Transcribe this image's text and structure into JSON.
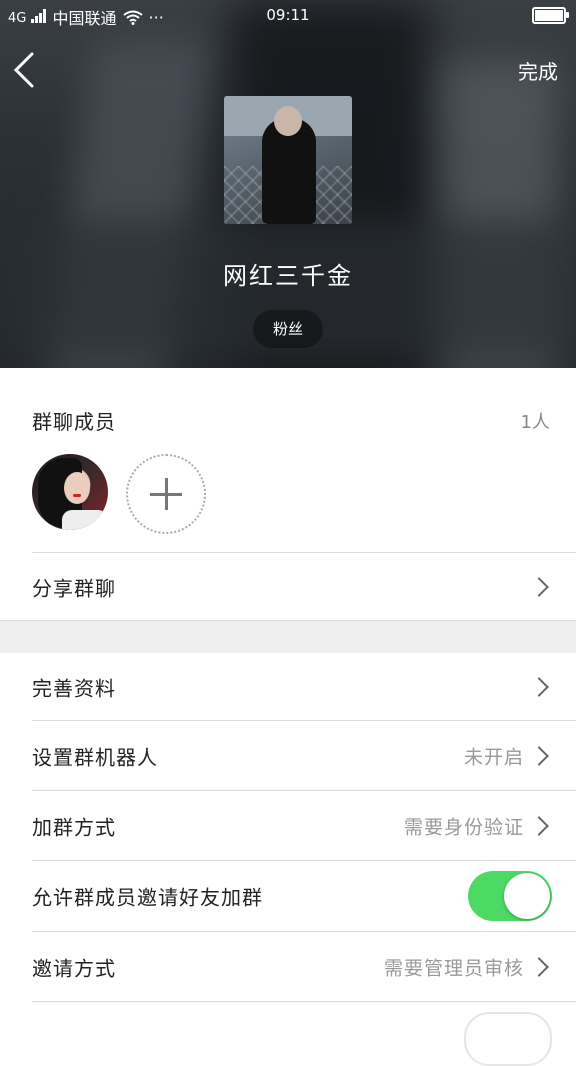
{
  "status_bar": {
    "carrier": "中国联通",
    "signal_label": "4G",
    "more": "···",
    "time": "09:11"
  },
  "header": {
    "done_label": "完成",
    "group_name": "网红三千金",
    "badge": "粉丝"
  },
  "members": {
    "title": "群聊成员",
    "count": "1人"
  },
  "rows": {
    "share": {
      "label": "分享群聊"
    },
    "profile": {
      "label": "完善资料"
    },
    "robot": {
      "label": "设置群机器人",
      "value": "未开启"
    },
    "join_method": {
      "label": "加群方式",
      "value": "需要身份验证"
    },
    "allow_invite": {
      "label": "允许群成员邀请好友加群",
      "toggle": true
    },
    "invite_method": {
      "label": "邀请方式",
      "value": "需要管理员审核"
    }
  },
  "colors": {
    "toggle_on": "#4cd964",
    "section_gap": "#efefef"
  }
}
